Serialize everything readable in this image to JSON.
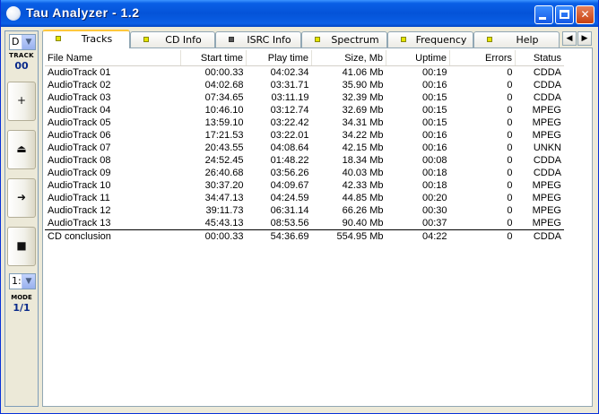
{
  "window": {
    "title": "Tau Analyzer - 1.2"
  },
  "left_panel": {
    "drive_value": "D",
    "track_label": "TRACK",
    "track_number": "00",
    "buttons": [
      {
        "icon": "plus-icon",
        "glyph": "+"
      },
      {
        "icon": "eject-icon",
        "glyph": "⏏"
      },
      {
        "icon": "arrow-right-icon",
        "glyph": "➜"
      },
      {
        "icon": "stop-icon",
        "glyph": "■"
      }
    ],
    "mode_value": "1:",
    "mode_label": "MODE",
    "mode_number": "1/1"
  },
  "tabs": [
    {
      "label": "Tracks",
      "active": true,
      "led": "yellow"
    },
    {
      "label": "CD Info",
      "active": false,
      "led": "yellow"
    },
    {
      "label": "ISRC Info",
      "active": false,
      "led": "gray"
    },
    {
      "label": "Spectrum",
      "active": false,
      "led": "yellow"
    },
    {
      "label": "Frequency",
      "active": false,
      "led": "yellow"
    },
    {
      "label": "Help",
      "active": false,
      "led": "yellow"
    }
  ],
  "table": {
    "columns": [
      "File Name",
      "Start time",
      "Play time",
      "Size, Mb",
      "Uptime",
      "Errors",
      "Status"
    ],
    "rows": [
      [
        "AudioTrack 01",
        "00:00.33",
        "04:02.34",
        "41.06 Mb",
        "00:19",
        "0",
        "CDDA"
      ],
      [
        "AudioTrack 02",
        "04:02.68",
        "03:31.71",
        "35.90 Mb",
        "00:16",
        "0",
        "CDDA"
      ],
      [
        "AudioTrack 03",
        "07:34.65",
        "03:11.19",
        "32.39 Mb",
        "00:15",
        "0",
        "CDDA"
      ],
      [
        "AudioTrack 04",
        "10:46.10",
        "03:12.74",
        "32.69 Mb",
        "00:15",
        "0",
        "MPEG"
      ],
      [
        "AudioTrack 05",
        "13:59.10",
        "03:22.42",
        "34.31 Mb",
        "00:15",
        "0",
        "MPEG"
      ],
      [
        "AudioTrack 06",
        "17:21.53",
        "03:22.01",
        "34.22 Mb",
        "00:16",
        "0",
        "MPEG"
      ],
      [
        "AudioTrack 07",
        "20:43.55",
        "04:08.64",
        "42.15 Mb",
        "00:16",
        "0",
        "UNKN"
      ],
      [
        "AudioTrack 08",
        "24:52.45",
        "01:48.22",
        "18.34 Mb",
        "00:08",
        "0",
        "CDDA"
      ],
      [
        "AudioTrack 09",
        "26:40.68",
        "03:56.26",
        "40.03 Mb",
        "00:18",
        "0",
        "CDDA"
      ],
      [
        "AudioTrack 10",
        "30:37.20",
        "04:09.67",
        "42.33 Mb",
        "00:18",
        "0",
        "MPEG"
      ],
      [
        "AudioTrack 11",
        "34:47.13",
        "04:24.59",
        "44.85 Mb",
        "00:20",
        "0",
        "MPEG"
      ],
      [
        "AudioTrack 12",
        "39:11.73",
        "06:31.14",
        "66.26 Mb",
        "00:30",
        "0",
        "MPEG"
      ],
      [
        "AudioTrack 13",
        "45:43.13",
        "08:53.56",
        "90.40 Mb",
        "00:37",
        "0",
        "MPEG"
      ]
    ],
    "summary": [
      "CD conclusion",
      "00:00.33",
      "54:36.69",
      "554.95 Mb",
      "04:22",
      "0",
      "CDDA"
    ]
  }
}
